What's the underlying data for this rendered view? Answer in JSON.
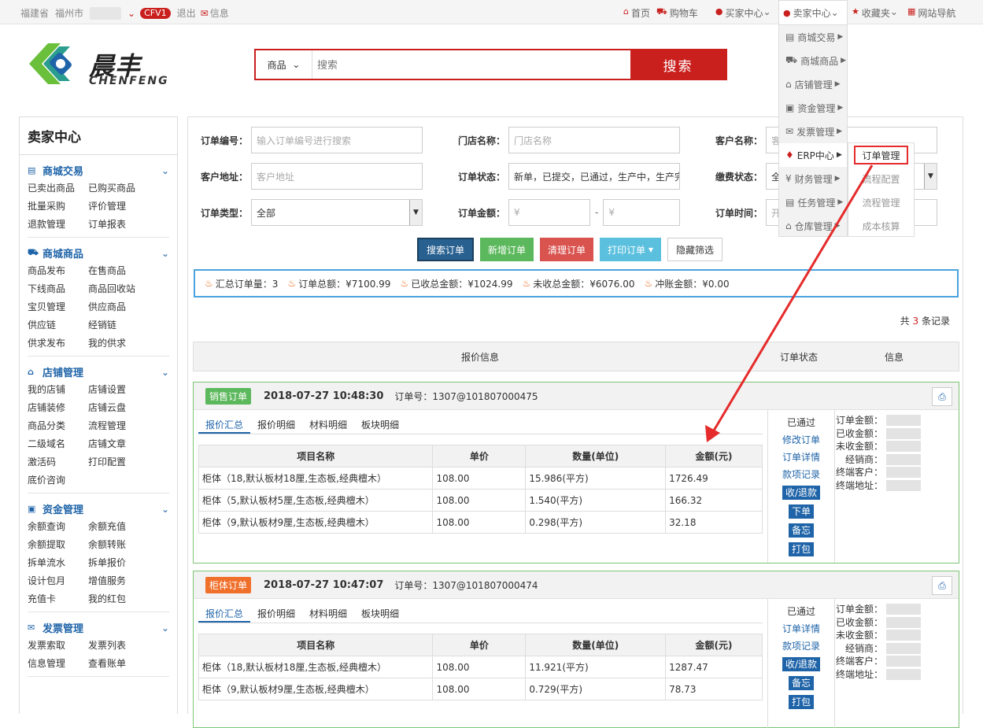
{
  "topbar": {
    "province": "福建省",
    "city": "福州市",
    "badge": "CFV1",
    "logout": "退出",
    "message": "信息",
    "home": "首页",
    "cart": "购物车",
    "buyer": "买家中心",
    "seller": "卖家中心",
    "fav": "收藏夹",
    "nav": "网站导航"
  },
  "logo": {
    "cn": "晨丰",
    "en": "CHENFENG"
  },
  "search": {
    "category": "商品",
    "placeholder": "搜索",
    "button": "搜索"
  },
  "sidebar": {
    "title": "卖家中心",
    "sections": [
      {
        "title": "商城交易",
        "items": [
          "已卖出商品",
          "已购买商品",
          "批量采购",
          "评价管理",
          "退款管理",
          "订单报表"
        ]
      },
      {
        "title": "商城商品",
        "items": [
          "商品发布",
          "在售商品",
          "下线商品",
          "商品回收站",
          "宝贝管理",
          "供应商品",
          "供应链",
          "经销链",
          "供求发布",
          "我的供求"
        ]
      },
      {
        "title": "店铺管理",
        "items": [
          "我的店铺",
          "店铺设置",
          "店铺装修",
          "店铺云盘",
          "商品分类",
          "流程管理",
          "二级域名",
          "店铺文章",
          "激活码",
          "打印配置",
          "底价咨询"
        ]
      },
      {
        "title": "资金管理",
        "items": [
          "余额查询",
          "余额充值",
          "余额提取",
          "余额转账",
          "拆单流水",
          "拆单报价",
          "设计包月",
          "增值服务",
          "充值卡",
          "我的红包"
        ]
      },
      {
        "title": "发票管理",
        "items": [
          "发票索取",
          "发票列表",
          "信息管理",
          "查看账单"
        ]
      }
    ]
  },
  "filters": {
    "order_no": "订单编号：",
    "order_no_ph": "输入订单编号进行搜索",
    "store": "门店名称：",
    "store_ph": "门店名称",
    "customer": "客户名称：",
    "customer_ph": "客",
    "address": "客户地址：",
    "address_ph": "客户地址",
    "status": "订单状态：",
    "status_val": "新单，已提交，已通过，生产中，生产完",
    "pay": "缴费状态：",
    "pay_val": "全",
    "type": "订单类型：",
    "type_val": "全部",
    "amount": "订单金额：",
    "amount_ph1": "¥",
    "amount_sep": "-",
    "amount_ph2": "¥",
    "time": "订单时间：",
    "time_ph": "开"
  },
  "buttons": {
    "search": "搜索订单",
    "add": "新增订单",
    "clear": "清理订单",
    "print": "打印订单",
    "hide": "隐藏筛选"
  },
  "summary": {
    "count": "汇总订单量：3",
    "total": "订单总额：¥7100.99",
    "received": "已收总金额：¥1024.99",
    "unreceived": "未收总金额：¥6076.00",
    "offset": "冲账金额：¥0.00"
  },
  "records": {
    "prefix": "共",
    "count": "3",
    "suffix": "条记录"
  },
  "list_header": {
    "quote": "报价信息",
    "status": "订单状态",
    "info": "信息"
  },
  "tabs": [
    "报价汇总",
    "报价明细",
    "材料明细",
    "板块明细"
  ],
  "columns": [
    "项目名称",
    "单价",
    "数量(单位)",
    "金额(元)"
  ],
  "orders": [
    {
      "tag": "销售订单",
      "tag_color": "#5cb85c",
      "datetime": "2018-07-27 10:48:30",
      "order_no": "订单号：1307@101807000475",
      "status": "已通过",
      "links": [
        "修改订单",
        "订单详情",
        "款项记录"
      ],
      "actions": [
        "收/退款",
        "下单",
        "备忘",
        "打包"
      ],
      "rows": [
        [
          "柜体（18,默认板材18厘,生态板,经典檀木）",
          "108.00",
          "15.986(平方)",
          "1726.49"
        ],
        [
          "柜体（5,默认板材5厘,生态板,经典檀木）",
          "108.00",
          "1.540(平方)",
          "166.32"
        ],
        [
          "柜体（9,默认板材9厘,生态板,经典檀木）",
          "108.00",
          "0.298(平方)",
          "32.18"
        ]
      ]
    },
    {
      "tag": "柜体订单",
      "tag_color": "#f0702b",
      "datetime": "2018-07-27 10:47:07",
      "order_no": "订单号：1307@101807000474",
      "status": "已通过",
      "links": [
        "订单详情",
        "款项记录"
      ],
      "actions": [
        "收/退款",
        "备忘",
        "打包"
      ],
      "rows": [
        [
          "柜体（18,默认板材18厘,生态板,经典檀木）",
          "108.00",
          "11.921(平方)",
          "1287.47"
        ],
        [
          "柜体（9,默认板材9厘,生态板,经典檀木）",
          "108.00",
          "0.729(平方)",
          "78.73"
        ]
      ]
    }
  ],
  "info_labels": [
    "订单金额：",
    "已收金额：",
    "未收金额：",
    "经销商：",
    "终端客户：",
    "终端地址："
  ],
  "menu": [
    "商城交易",
    "商城商品",
    "店铺管理",
    "资金管理",
    "发票管理",
    "ERP中心",
    "财务管理",
    "任务管理",
    "仓库管理"
  ],
  "submenu": [
    "订单管理",
    "流程配置",
    "流程管理",
    "成本核算"
  ]
}
